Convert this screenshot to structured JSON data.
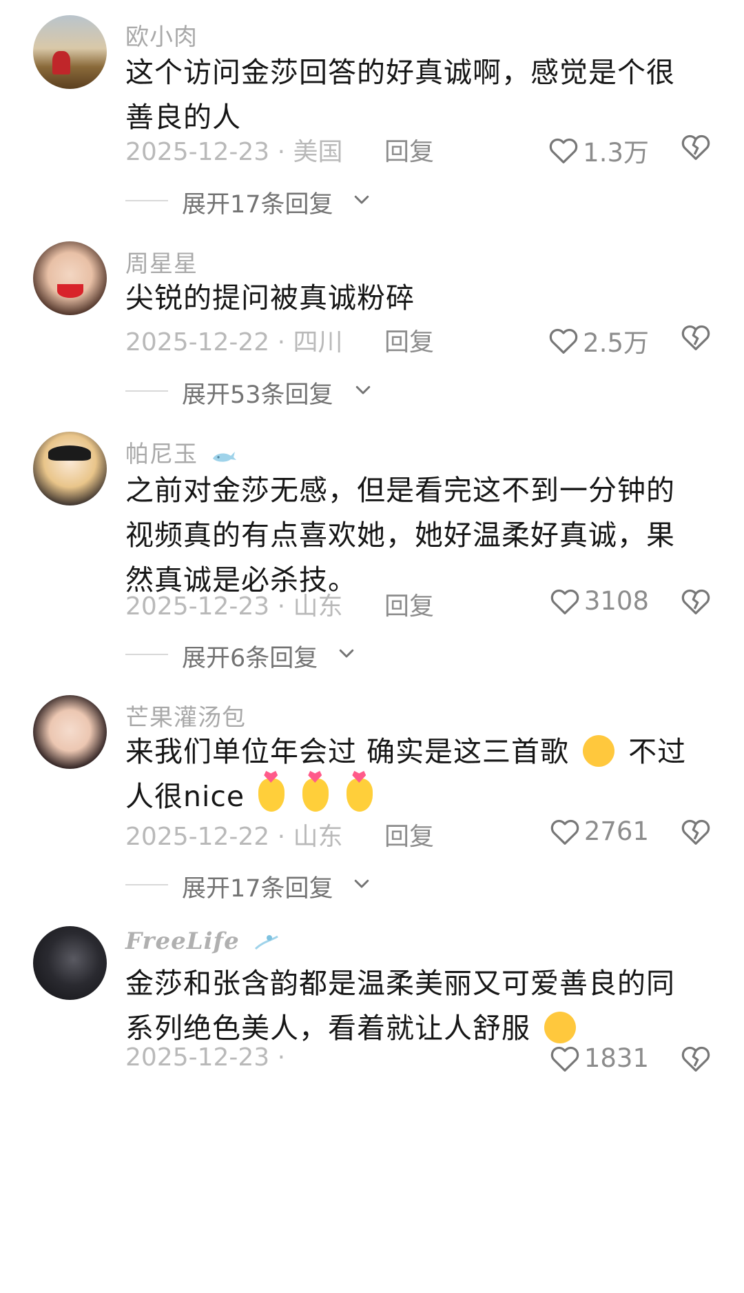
{
  "comments": [
    {
      "username": "欧小肉",
      "text": "这个访问金莎回答的好真诚啊，感觉是个很善良的人",
      "date_location": "2025-12-23 · 美国",
      "reply_label": "回复",
      "likes": "1.3万",
      "expand_label": "展开17条回复",
      "avatar_icon": "avatar-sunset-field"
    },
    {
      "username": "周星星",
      "text": "尖锐的提问被真诚粉碎",
      "date_location": "2025-12-22 · 四川",
      "reply_label": "回复",
      "likes": "2.5万",
      "expand_label": "展开53条回复",
      "avatar_icon": "avatar-smiling-face"
    },
    {
      "username": "帕尼玉",
      "username_badge_icon": "whale-icon",
      "text": "之前对金莎无感，但是看完这不到一分钟的视频真的有点喜欢她，她好温柔好真诚，果然真诚是必杀技。",
      "date_location": "2025-12-23 · 山东",
      "reply_label": "回复",
      "likes": "3108",
      "expand_label": "展开6条回复",
      "avatar_icon": "avatar-anime-girl"
    },
    {
      "username": "芒果灌汤包",
      "text_a": "来我们单位年会过 确实是这三首歌",
      "text_b": "不过人很nice",
      "emoji_a": "crying-face-emoji",
      "emoji_b": "heart-hands-emoji",
      "date_location": "2025-12-22 · 山东",
      "reply_label": "回复",
      "likes": "2761",
      "expand_label": "展开17条回复",
      "avatar_icon": "avatar-girl-portrait"
    },
    {
      "username": "FreeLife",
      "username_badge_icon": "surf-icon",
      "text_a": "金莎和张含韵都是温柔美丽又可爱善良的同系列绝色美人，看着就让人舒服",
      "emoji_a": "relieved-face-emoji",
      "date_location": "2025-12-23 ·",
      "reply_label": "",
      "likes": "1831",
      "avatar_icon": "avatar-dark-portrait"
    }
  ],
  "icons": {
    "like": "heart-outline-icon",
    "dislike": "broken-heart-icon",
    "expand": "chevron-down-icon"
  },
  "colors": {
    "username": "#a9a9a9",
    "text": "#161616",
    "meta": "#b9b9b9",
    "action": "#8c8c8c"
  }
}
